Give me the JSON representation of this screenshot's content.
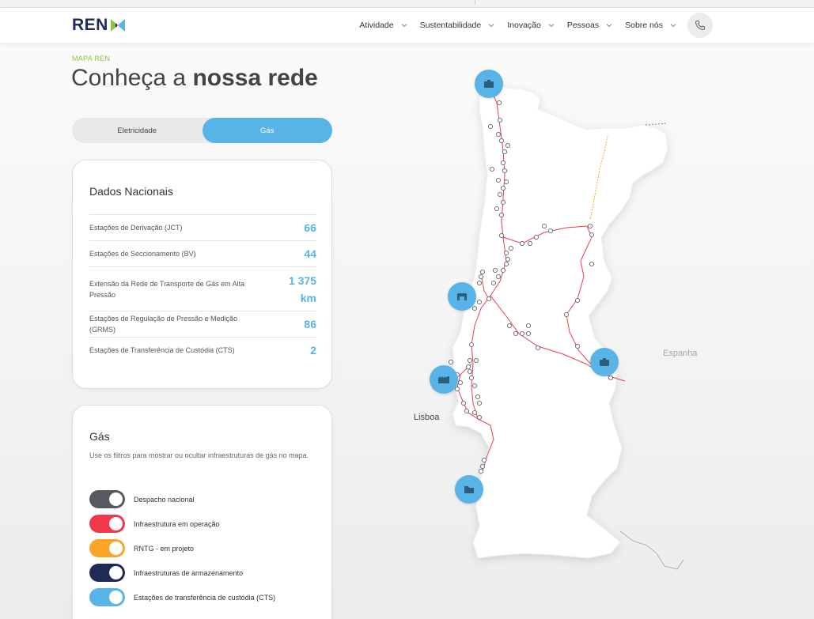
{
  "brand": {
    "name": "REN",
    "colors": {
      "navy": "#1f2a55",
      "green": "#8dc63f",
      "blue": "#58b3e6"
    }
  },
  "nav": {
    "items": [
      {
        "label": "Atividade"
      },
      {
        "label": "Sustentabilidade"
      },
      {
        "label": "Inovação"
      },
      {
        "label": "Pessoas"
      },
      {
        "label": "Sobre nós"
      }
    ],
    "phone_icon": "phone-icon"
  },
  "hero": {
    "eyebrow": "MAPA REN",
    "title_light": "Conheça a ",
    "title_bold": "nossa rede"
  },
  "tabs": {
    "electricity": "Eletricidade",
    "gas": "Gás",
    "active": "gas"
  },
  "national": {
    "title": "Dados Nacionais",
    "rows": [
      {
        "label": "Estações de Derivação (JCT)",
        "value": "66"
      },
      {
        "label": "Estações de Seccionamento (BV)",
        "value": "44"
      },
      {
        "label": "Extensão da Rede de Transporte de Gás em Alta Pressão",
        "value": "1 375 km"
      },
      {
        "label": "Estações de Regulação de Pressão e Medição (GRMS)",
        "value": "86"
      },
      {
        "label": "Estações de Transferência de Custódia (CTS)",
        "value": "2"
      }
    ]
  },
  "gas_filters": {
    "title": "Gás",
    "description": "Use os filtros para mostrar ou ocultar infraestruturas de gás no mapa.",
    "toggles": [
      {
        "label": "Despacho nacional",
        "color": "#545a5f",
        "on": true
      },
      {
        "label": "Infraestrutura em operação",
        "color": "#f0384a",
        "on": true
      },
      {
        "label": "RNTG - em projeto",
        "color": "#f9a527",
        "on": true
      },
      {
        "label": "Infraestruturas de armazenamento",
        "color": "#1f2a55",
        "on": true
      },
      {
        "label": "Estações de transferência de custódia (CTS)",
        "color": "#58b3e6",
        "on": true
      }
    ]
  },
  "map": {
    "label_spain": "Espanha",
    "label_lisboa": "Lisboa"
  }
}
